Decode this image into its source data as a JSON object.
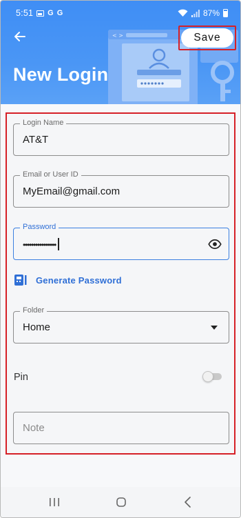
{
  "status_bar": {
    "time": "5:51",
    "notification_glyphs": [
      "G",
      "G"
    ],
    "battery_percent": "87%",
    "icons": [
      "gallery-icon",
      "wifi-icon",
      "signal-icon",
      "battery-icon"
    ]
  },
  "header": {
    "title": "New Login",
    "save_label": "Save",
    "background_color": "#4a96f5"
  },
  "form": {
    "login_name": {
      "label": "Login Name",
      "value": "AT&T"
    },
    "email": {
      "label": "Email or User ID",
      "value": "MyEmail@gmail.com"
    },
    "password": {
      "label": "Password",
      "masked_value": "••••••••••••••••"
    },
    "generate_password_label": "Generate Password",
    "folder": {
      "label": "Folder",
      "value": "Home"
    },
    "pin": {
      "label": "Pin",
      "enabled": false
    },
    "note": {
      "placeholder": "Note"
    }
  },
  "colors": {
    "accent": "#2f6fd6",
    "highlight_border": "#d61f26"
  },
  "nav": {
    "buttons": [
      "recents-icon",
      "home-icon",
      "back-icon"
    ]
  }
}
